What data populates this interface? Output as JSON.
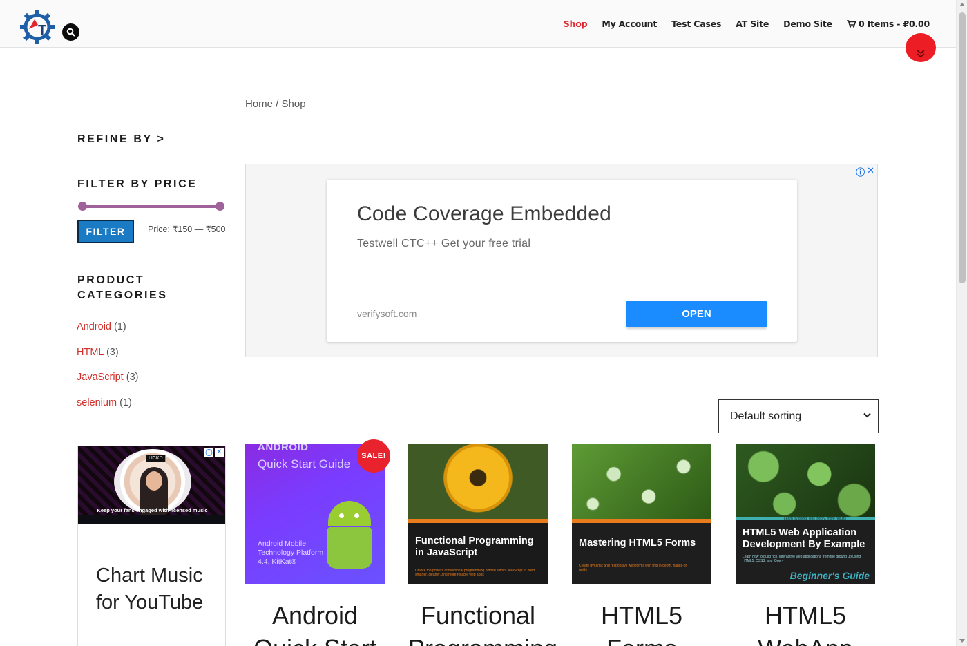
{
  "header": {
    "nav": [
      {
        "label": "Shop",
        "active": true
      },
      {
        "label": "My Account",
        "active": false
      },
      {
        "label": "Test Cases",
        "active": false
      },
      {
        "label": "AT Site",
        "active": false
      },
      {
        "label": "Demo Site",
        "active": false
      }
    ],
    "cart_label": "0 Items - ₽0.00",
    "icons": [
      "site-logo",
      "search-icon",
      "cart-icon",
      "chevron-double-down-icon"
    ],
    "accent_color": "#e0272d"
  },
  "breadcrumb": {
    "home": "Home",
    "separator": " / ",
    "current": "Shop"
  },
  "sidebar": {
    "refine_heading": "REFINE BY >",
    "price_heading": "FILTER BY PRICE",
    "filter_button": "FILTER",
    "price_prefix": "Price: ",
    "price_range": "₹150 — ₹500",
    "categories_heading_line1": "PRODUCT",
    "categories_heading_line2": "CATEGORIES",
    "categories": [
      {
        "name": "Android",
        "count": "(1)"
      },
      {
        "name": "HTML",
        "count": "(3)"
      },
      {
        "name": "JavaScript",
        "count": "(3)"
      },
      {
        "name": "selenium",
        "count": "(1)"
      }
    ],
    "ad": {
      "image_tag": "LICKD",
      "image_caption": "Keep your fans engaged with licensed music",
      "title": "Chart Music for YouTube"
    }
  },
  "main_ad": {
    "title": "Code Coverage Embedded",
    "subtitle": "Testwell CTC++ Get your free trial",
    "domain": "verifysoft.com",
    "button": "OPEN"
  },
  "sorting": {
    "selected": "Default sorting"
  },
  "products": [
    {
      "sale_badge": "SALE!",
      "cover_line1": "ANDROID",
      "cover_line2": "Quick Start Guide",
      "cover_line3": "Android Mobile Technology Platform 4.4, KitKat®",
      "title_line1": "Android",
      "title_line2": "Quick Start"
    },
    {
      "cover_title": "Functional Programming in JavaScript",
      "cover_text": "Unlock the powers of functional programming hidden within JavaScript to build smarter, cleaner, and more reliable web apps",
      "title_line1": "Functional",
      "title_line2": "Programming"
    },
    {
      "cover_title": "Mastering HTML5 Forms",
      "cover_text": "Create dynamic and responsive web forms with this in-depth, hands-on guide",
      "title_line1": "HTML5",
      "title_line2": "Forms"
    },
    {
      "cover_title": "HTML5 Web Application Development By Example",
      "cover_text": "Learn how to build rich, interactive web applications from the ground up using HTML5, CSS3, and jQuery",
      "cover_band": "Learn by doing: less theory, more results",
      "cover_guide": "Beginner's Guide",
      "title_line1": "HTML5",
      "title_line2": "WebApp"
    }
  ]
}
